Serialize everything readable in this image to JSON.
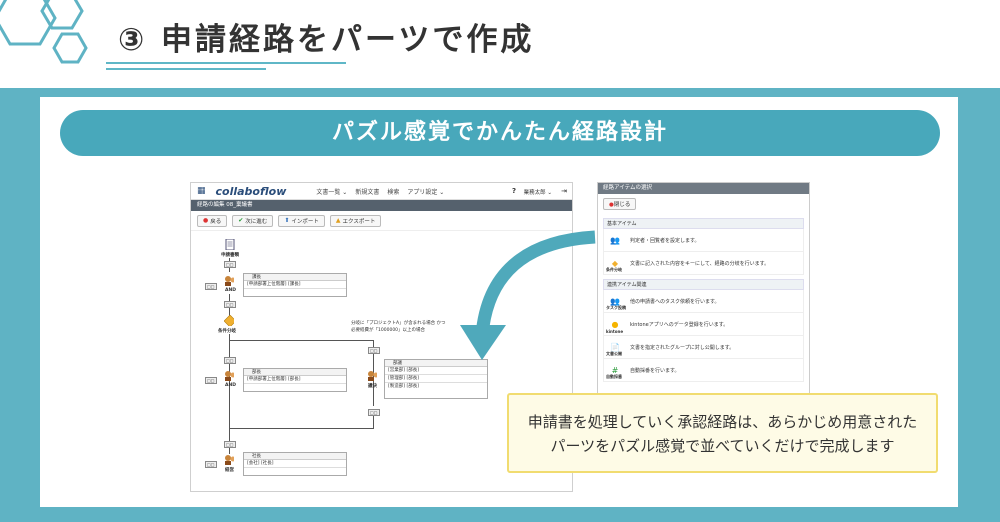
{
  "slide": {
    "title": "③ 申請経路をパーツで作成",
    "banner": "パズル感覚でかんたん経路設計",
    "callout_line1": "申請書を処理していく承認経路は、あらかじめ用意された",
    "callout_line2": "パーツをパズル感覚で並べていくだけで完成します"
  },
  "colors": {
    "teal": "#5fb3c4",
    "banner": "#48a8bb",
    "callout_bg": "#fefbe6",
    "callout_border": "#f1dc70",
    "navy": "#2a4d7a"
  },
  "app": {
    "logo": "collaboflow",
    "menu": [
      "文書一覧 ⌄",
      "新規文書",
      "検索",
      "アプリ設定 ⌄"
    ],
    "help": "?",
    "user": "業務太郎 ⌄",
    "subbar": "経路の編集 08_稟議書",
    "toolbar": {
      "back": "戻る",
      "next": "次に進む",
      "import": "インポート",
      "export": "エクスポート"
    },
    "form_name": "08_稟議書",
    "nodes": {
      "start_label": "申請書類",
      "and1": "AND",
      "box1_title": "課長",
      "box1_row": "[申請部署上位階層] [課長]",
      "cond_label": "条件分岐",
      "cond_note_line1": "分岐に「プロジェクトA」が含まれる場合 かつ",
      "cond_note_line2": "必要経費が「1000000」以上の場合",
      "and2": "AND",
      "box2_title": "部長",
      "box2_row": "[申請部署上位階層] [部長]",
      "parallel_label": "議決",
      "box3_title": "部議",
      "box3_rows": [
        "[営業部] [部長]",
        "[管理部] [部長]",
        "[製造部] [部長]"
      ],
      "final_label": "経営",
      "box4_title": "社長",
      "box4_row": "[会社] [社長]",
      "tag": "□□"
    }
  },
  "panel": {
    "header": "経路アイテムの選択",
    "close": "閉じる",
    "basic_section": "基本アイテム",
    "basic_items": [
      {
        "label": "",
        "desc": "判定者・回覧者を設定します。",
        "icon": "people-icon"
      },
      {
        "label": "条件分岐",
        "desc": "文書に記入された内容をキーにして、経路の分岐を行います。",
        "icon": "diamond-icon"
      }
    ],
    "link_section": "連携アイテム関連",
    "link_items": [
      {
        "label": "タスク投稿",
        "desc": "他の申請書へのタスク依頼を行います。",
        "icon": "task-icon"
      },
      {
        "label": "kintone",
        "desc": "kintoneアプリへのデータ登録を行います。",
        "icon": "kintone-icon"
      },
      {
        "label": "文書公開",
        "desc": "文書を指定されたグループに対し公開します。",
        "icon": "publish-icon"
      },
      {
        "label": "自動採番",
        "desc": "自動採番を行います。",
        "icon": "numbering-icon"
      }
    ]
  }
}
